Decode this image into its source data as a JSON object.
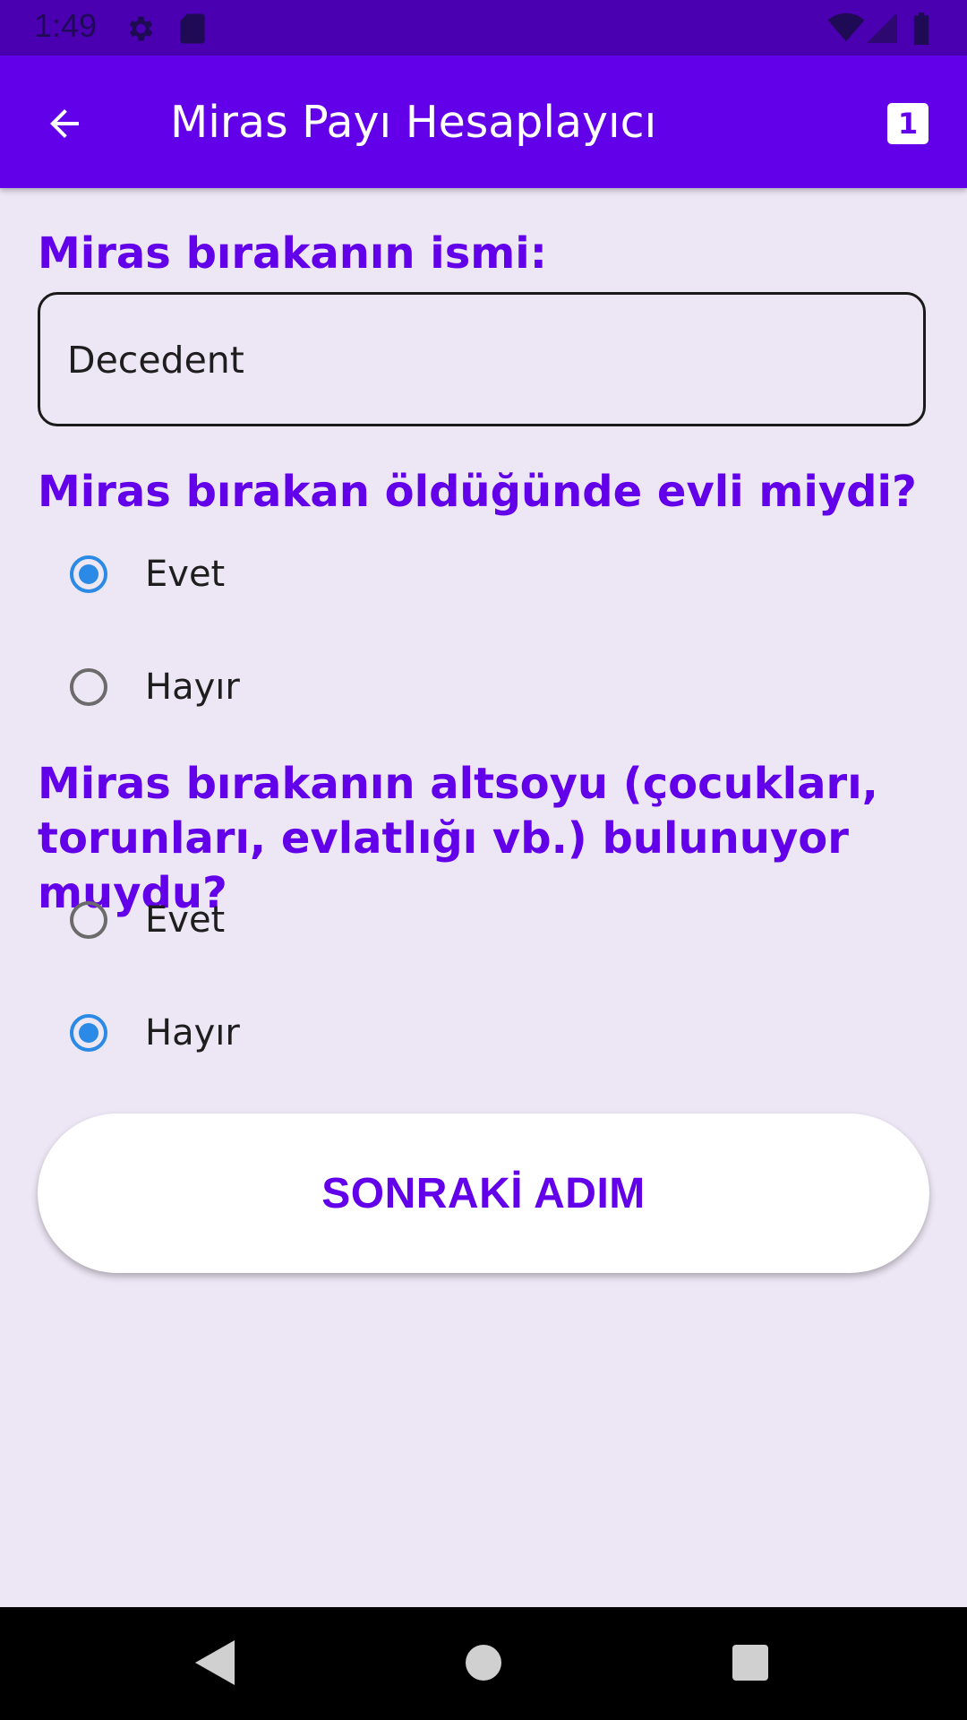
{
  "status_bar": {
    "time": "1:49",
    "icons": [
      "gear-icon",
      "sd-card-icon",
      "wifi-icon",
      "signal-icon",
      "battery-icon"
    ]
  },
  "app_bar": {
    "title": "Miras Payı Hesaplayıcı",
    "badge_number": "1",
    "color": "#6200ea"
  },
  "form": {
    "name_label": "Miras bırakanın ismi:",
    "name_value": "Decedent",
    "married_question": "Miras bırakan öldüğünde evli miydi?",
    "married_options": [
      {
        "label": "Evet",
        "selected": true
      },
      {
        "label": "Hayır",
        "selected": false
      }
    ],
    "descendants_question": "Miras bırakanın altsoyu (çocukları, torunları, evlatlığı vb.) bulunuyor muydu?",
    "descendants_options": [
      {
        "label": "Evet",
        "selected": false
      },
      {
        "label": "Hayır",
        "selected": true
      }
    ],
    "next_button": "SONRAKİ ADIM"
  },
  "nav_bar": {
    "buttons": [
      "back-triangle-icon",
      "home-circle-icon",
      "recents-square-icon"
    ]
  }
}
